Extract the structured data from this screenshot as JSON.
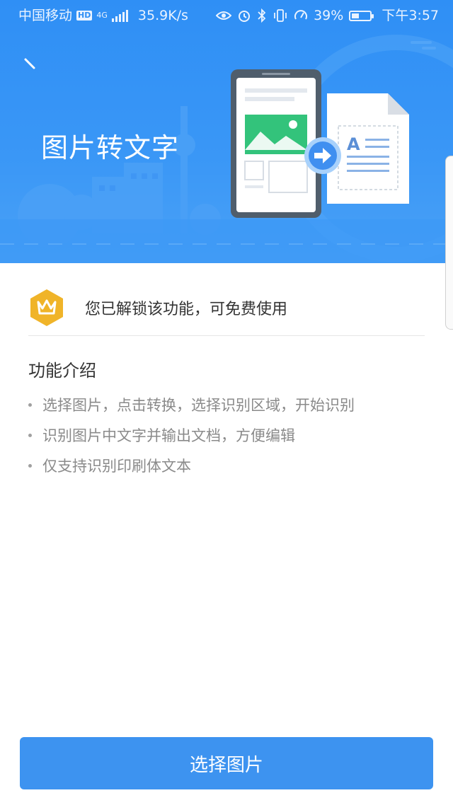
{
  "status_bar": {
    "carrier": "中国移动",
    "hd": "HD",
    "network": "4G",
    "speed": "35.9K/s",
    "battery_percent": "39%",
    "time": "下午3:57",
    "icons": [
      "eye-icon",
      "alarm-icon",
      "bluetooth-icon",
      "vibrate-icon",
      "speed-icon",
      "battery-icon"
    ]
  },
  "header": {
    "title": "图片转文字",
    "colors": {
      "background": "#2f8ff5",
      "accent_green": "#33c37b"
    }
  },
  "unlock": {
    "text": "您已解锁该功能，可免费使用",
    "icon": "crown-icon",
    "icon_color": "#f0b429"
  },
  "intro": {
    "title": "功能介绍",
    "items": [
      "选择图片，点击转换，选择识别区域，开始识别",
      "识别图片中文字并输出文档，方便编辑",
      "仅支持识别印刷体文本"
    ]
  },
  "actions": {
    "select_image": "选择图片",
    "button_color": "#3d93f0"
  }
}
